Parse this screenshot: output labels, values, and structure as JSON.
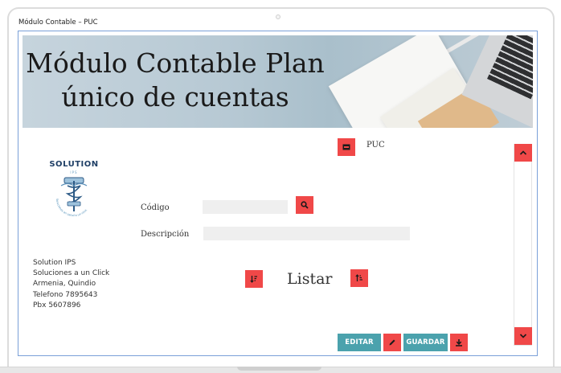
{
  "window": {
    "title": "Módulo Contable – PUC"
  },
  "banner": {
    "title": "Módulo Contable Plan único de cuentas"
  },
  "logo": {
    "name": "SOLUTION",
    "sub": "IPS",
    "ring_text": "Soluciones en salud a un click"
  },
  "puc_section": {
    "label": "PUC"
  },
  "form": {
    "codigo_label": "Código",
    "codigo_value": "",
    "descripcion_label": "Descripción",
    "descripcion_value": ""
  },
  "listar": {
    "label": "Listar"
  },
  "actions": {
    "editar_label": "EDITAR",
    "guardar_label": "GUARDAR"
  },
  "address": {
    "lines": [
      "Solution IPS",
      "Soluciones a un Click",
      "Armenia, Quindio",
      "Telefono 7895643",
      "Pbx 5607896"
    ]
  },
  "icons": {
    "puc": "card-icon",
    "search": "search-icon",
    "sort_asc": "sort-ascending-icon",
    "sort_desc": "sort-descending-icon",
    "edit": "pencil-icon",
    "download": "download-icon",
    "scroll_up": "chevron-up-icon",
    "scroll_down": "chevron-down-icon"
  },
  "colors": {
    "accent_red": "#f04848",
    "teal": "#4ba2ad",
    "border_blue": "#7aa0d8"
  }
}
